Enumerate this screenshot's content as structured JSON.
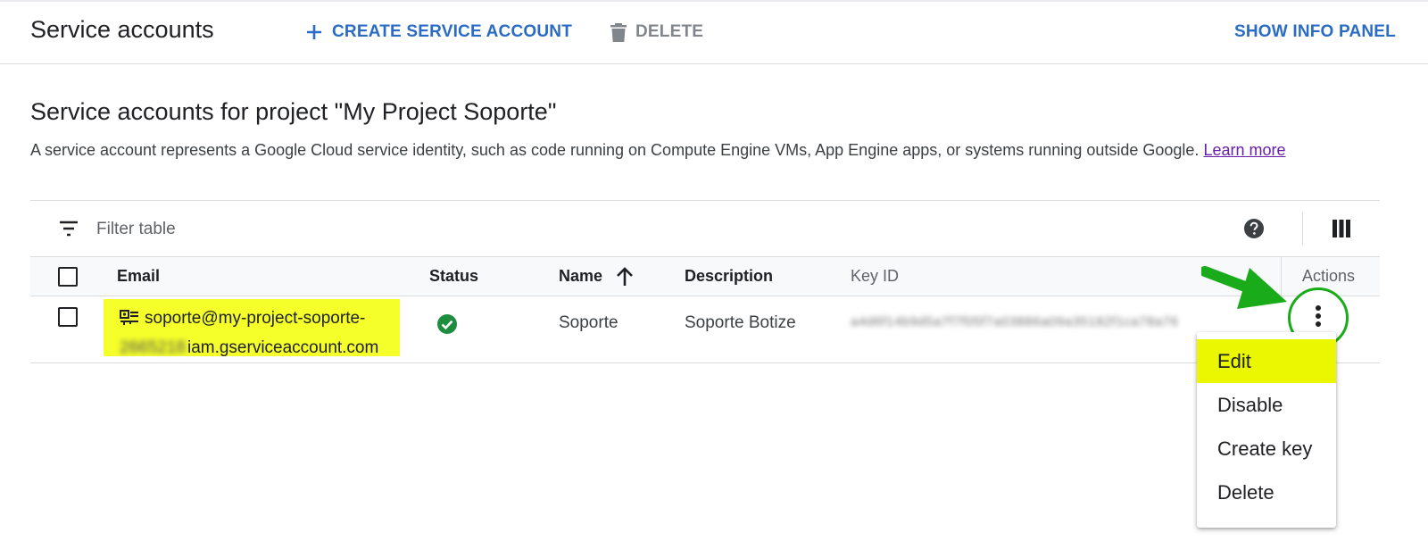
{
  "toolbar": {
    "title": "Service accounts",
    "create_label": "CREATE SERVICE ACCOUNT",
    "delete_label": "DELETE",
    "info_panel_label": "SHOW INFO PANEL"
  },
  "section": {
    "title": "Service accounts for project \"My Project Soporte\"",
    "description": "A service account represents a Google Cloud service identity, such as code running on Compute Engine VMs, App Engine apps, or systems running outside Google.",
    "learn_more": "Learn more"
  },
  "filter": {
    "placeholder": "Filter table"
  },
  "table": {
    "columns": {
      "email": "Email",
      "status": "Status",
      "name": "Name",
      "description": "Description",
      "key_id": "Key ID",
      "actions": "Actions"
    },
    "rows": [
      {
        "email_line1": "soporte@my-project-soporte-",
        "email_blurred": "2665218",
        "email_line2": "iam.gserviceaccount.com",
        "status": "enabled",
        "name": "Soporte",
        "description": "Soporte Botize",
        "key_id": "a4d6f14b9d5a7f7f05f7a03886a09a35182f1ca78a76"
      }
    ]
  },
  "menu": {
    "items": [
      "Edit",
      "Disable",
      "Create key",
      "Delete"
    ]
  },
  "colors": {
    "primary_blue": "#2a6bc5",
    "highlight_yellow": "#f5ff2a",
    "annotation_green": "#1aab1a",
    "status_green": "#1e8e3e"
  },
  "icons": {
    "create": "plus-icon",
    "delete": "trash-icon",
    "filter": "filter-icon",
    "help": "help-icon",
    "columns": "columns-icon",
    "sort": "arrow-up-icon",
    "status": "check-circle-icon",
    "key": "service-account-key-icon",
    "actions": "more-vert-icon"
  }
}
